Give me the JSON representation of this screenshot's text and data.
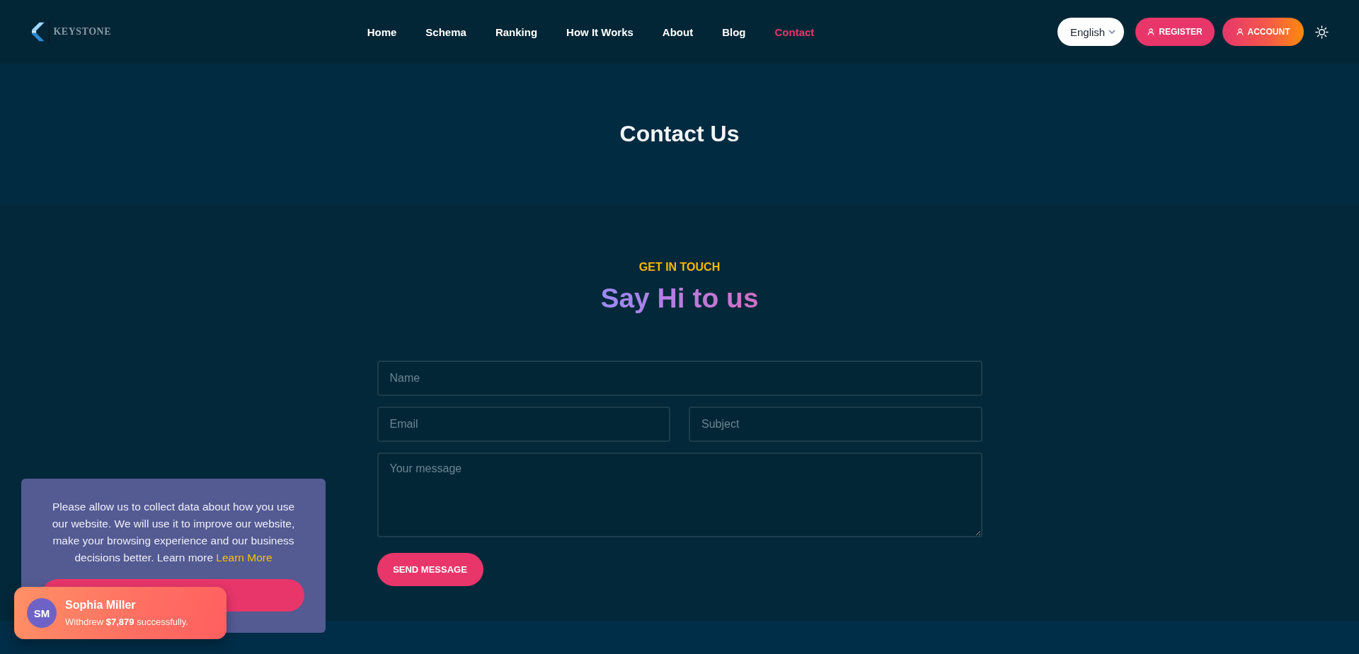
{
  "header": {
    "logo": {
      "wordmark": "KEYSTONE"
    },
    "nav": [
      {
        "label": "Home",
        "selected": false
      },
      {
        "label": "Schema",
        "selected": false
      },
      {
        "label": "Ranking",
        "selected": false
      },
      {
        "label": "How It Works",
        "selected": false
      },
      {
        "label": "About",
        "selected": false
      },
      {
        "label": "Blog",
        "selected": false
      },
      {
        "label": "Contact",
        "selected": true
      }
    ],
    "language": {
      "value": "English"
    },
    "buttons": [
      {
        "label": "REGISTER",
        "kind": "solid"
      },
      {
        "label": "ACCOUNT",
        "kind": "gradient"
      }
    ]
  },
  "hero": {
    "title": "Contact Us"
  },
  "contact": {
    "eyebrow": "GET IN TOUCH",
    "heading": "Say Hi to us",
    "rows": [
      [
        {
          "kind": "input",
          "placeholder": "Name"
        }
      ],
      [
        {
          "kind": "input",
          "placeholder": "Email"
        },
        {
          "kind": "input",
          "placeholder": "Subject"
        }
      ],
      [
        {
          "kind": "textarea",
          "placeholder": "Your message"
        }
      ]
    ],
    "submit": "SEND MESSAGE"
  },
  "cookie_notice": {
    "text": "Please allow us to collect data about how you use our website. We will use it to improve our website, make your browsing experience and our business decisions better. Learn more",
    "link": "Learn More"
  },
  "toast": {
    "initials": "SM",
    "name": "Sophia Miller",
    "message": "Withdrew **$7,879** successfully."
  }
}
